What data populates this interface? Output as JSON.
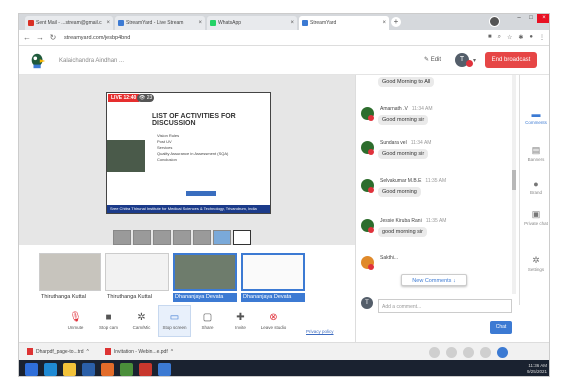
{
  "browser": {
    "tabs": [
      {
        "label": "Sent Mail - ...stream@gmail.c",
        "color": "#d93025"
      },
      {
        "label": "StreamYard - Live Stream",
        "color": "#3c7ad3"
      },
      {
        "label": "WhatsApp",
        "color": "#25d366"
      },
      {
        "label": "StreamYard",
        "color": "#3c7ad3"
      }
    ],
    "new_tab": "+",
    "url": "streamyard.com/jesbp4bnd"
  },
  "app": {
    "room_title": "Kalaichandra Aindhan ...",
    "edit_label": "Edit",
    "avatar_letter": "T",
    "end_broadcast": "End broadcast"
  },
  "stage": {
    "live_label": "LIVE 12:40",
    "view_count": "23",
    "slide_title": "LIST OF ACTIVITIES FOR DISCUSSION",
    "bullets": [
      "Vision Rules",
      "Post UV",
      "Services",
      "Quality Assurance in Assessment (SQA)",
      "Conclusion"
    ],
    "footer": "Sree Chitra Thirunal Institute for Medical Sciences & Technology, Trivandrum, India"
  },
  "thumbnails": [
    {
      "name": "Thiruthanga Kuttal",
      "active": false
    },
    {
      "name": "Thiruthanga Kuttal",
      "active": false
    },
    {
      "name": "Dhananjaya Devata",
      "active": true
    },
    {
      "name": "Dhananjaya Devata",
      "active": true
    }
  ],
  "toolbar": {
    "items": [
      {
        "icon": "mic-icon",
        "glyph": "🎙",
        "label": "Unmute"
      },
      {
        "icon": "camera-icon",
        "glyph": "■",
        "label": "Stop cam"
      },
      {
        "icon": "settings-icon",
        "glyph": "✲",
        "label": "Cam/Mic"
      },
      {
        "icon": "screen-icon",
        "glyph": "▭",
        "label": "Stop screen"
      },
      {
        "icon": "share-icon",
        "glyph": "▢",
        "label": "Share"
      },
      {
        "icon": "invite-icon",
        "glyph": "✚",
        "label": "Invite"
      },
      {
        "icon": "leave-icon",
        "glyph": "⊗",
        "label": "Leave studio"
      }
    ],
    "privacy": "Privacy policy"
  },
  "chat": {
    "messages": [
      {
        "name": "",
        "time": "",
        "text": "Good Morning to All"
      },
      {
        "name": "Amarnath .V",
        "time": "11:34 AM",
        "text": "Good morning sir"
      },
      {
        "name": "Sundara vel",
        "time": "11:34 AM",
        "text": "Good morning sir"
      },
      {
        "name": "Selvakumar M.B.E",
        "time": "11:35 AM",
        "text": "Good morning"
      },
      {
        "name": "Jessie Kiruba Rani",
        "time": "11:35 AM",
        "text": "good morning sir"
      },
      {
        "name": "Sakthi...",
        "time": "",
        "text": ""
      }
    ],
    "new_comments": "New Comments ↓",
    "composer_placeholder": "Add a comment...",
    "composer_avatar": "T",
    "chat_button": "Chat"
  },
  "rail": {
    "items": [
      {
        "icon": "comments-icon",
        "glyph": "▬",
        "label": "Comments"
      },
      {
        "icon": "banners-icon",
        "glyph": "▤",
        "label": "Banners"
      },
      {
        "icon": "brand-icon",
        "glyph": "●",
        "label": "Brand"
      },
      {
        "icon": "private-chat-icon",
        "glyph": "▣",
        "label": "Private chat"
      },
      {
        "icon": "settings-icon",
        "glyph": "✲",
        "label": "Settings"
      }
    ]
  },
  "downloads": [
    {
      "name": "Dharpdf_page-to...trd"
    },
    {
      "name": "Invitation - Webin...e.pdf"
    }
  ],
  "taskbar": {
    "time": "11:36 AM",
    "date": "9/25/2021"
  }
}
